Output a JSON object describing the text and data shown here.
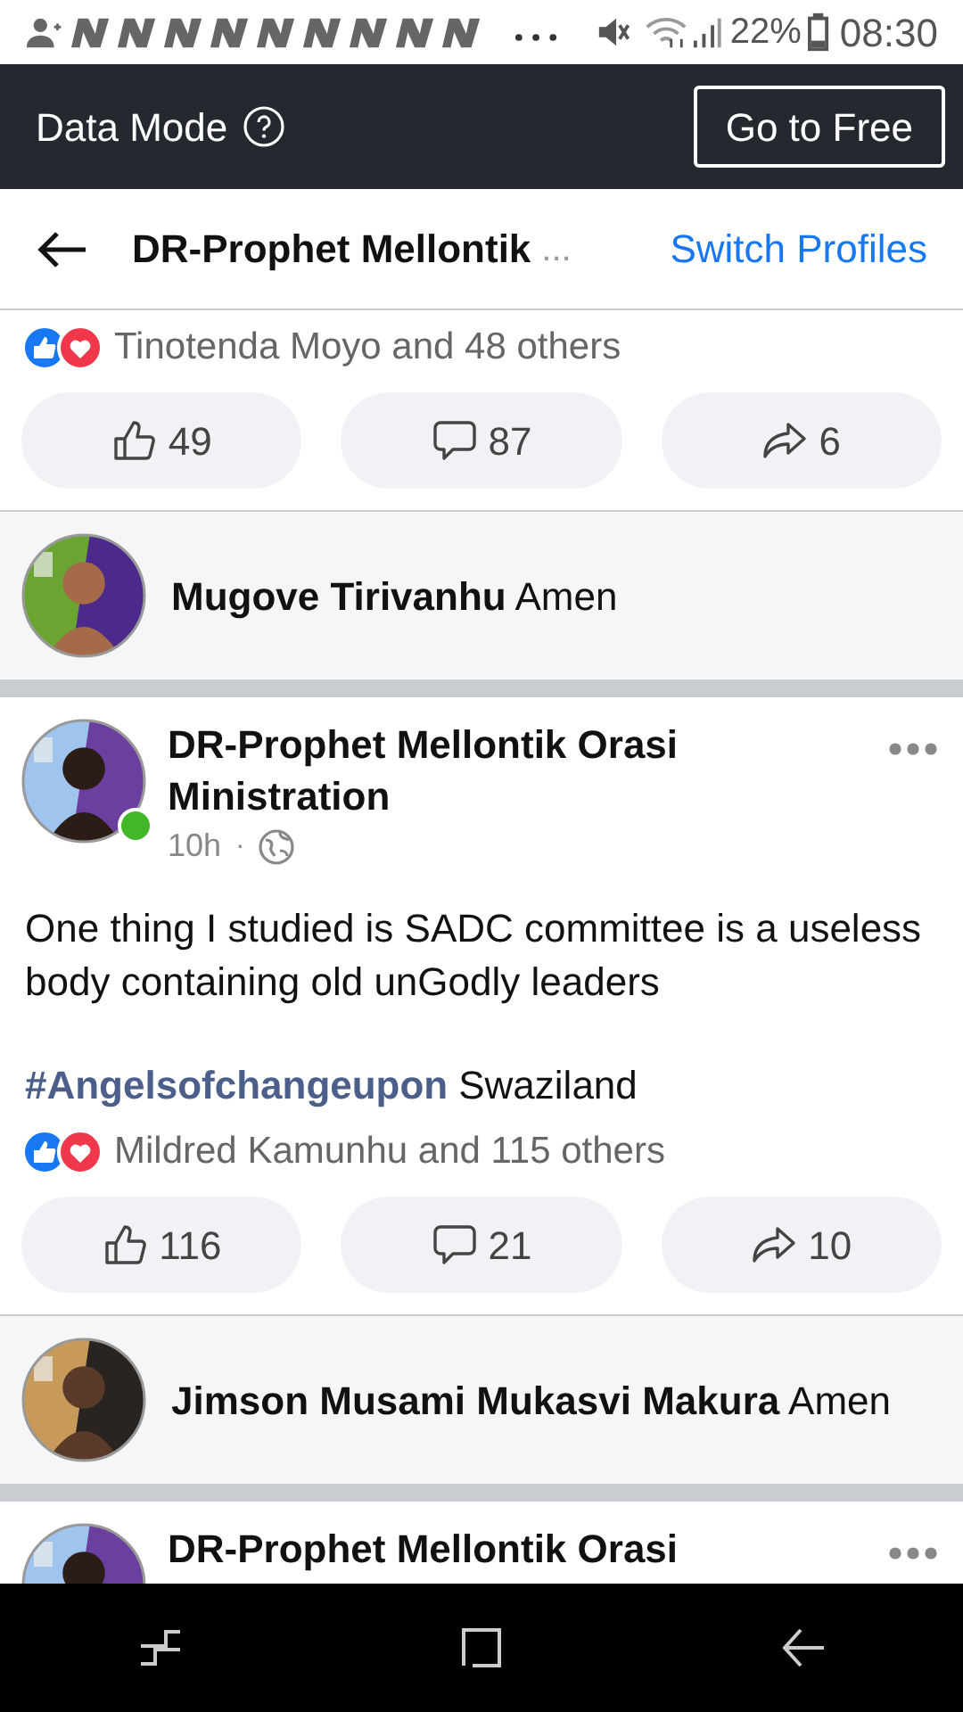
{
  "status_bar": {
    "battery": "22%",
    "time": "08:30"
  },
  "data_mode_bar": {
    "label": "Data Mode",
    "button": "Go to Free"
  },
  "header": {
    "title": "DR-Prophet Mellontik",
    "overflow": "...",
    "action": "Switch Profiles"
  },
  "posts": [
    {
      "reactions_text": "Tinotenda Moyo and 48 others",
      "actions": {
        "like": "49",
        "comment": "87",
        "share": "6"
      },
      "top_comment": {
        "name": "Mugove Tirivanhu",
        "text": "Amen"
      }
    },
    {
      "author": "DR-Prophet Mellontik Orasi Ministration",
      "online": true,
      "time": "10h",
      "separator": "·",
      "body": "One thing I studied is SADC committee is a useless body containing old unGodly leaders",
      "tag_line": {
        "tag": "#Angelsofchangeupon",
        "text": "Swaziland"
      },
      "reactions_text": "Mildred Kamunhu and 115 others",
      "actions": {
        "like": "116",
        "comment": "21",
        "share": "10"
      },
      "top_comment": {
        "name": "Jimson Musami Mukasvi Makura",
        "text": "Amen"
      }
    },
    {
      "author": "DR-Prophet Mellontik Orasi"
    }
  ]
}
